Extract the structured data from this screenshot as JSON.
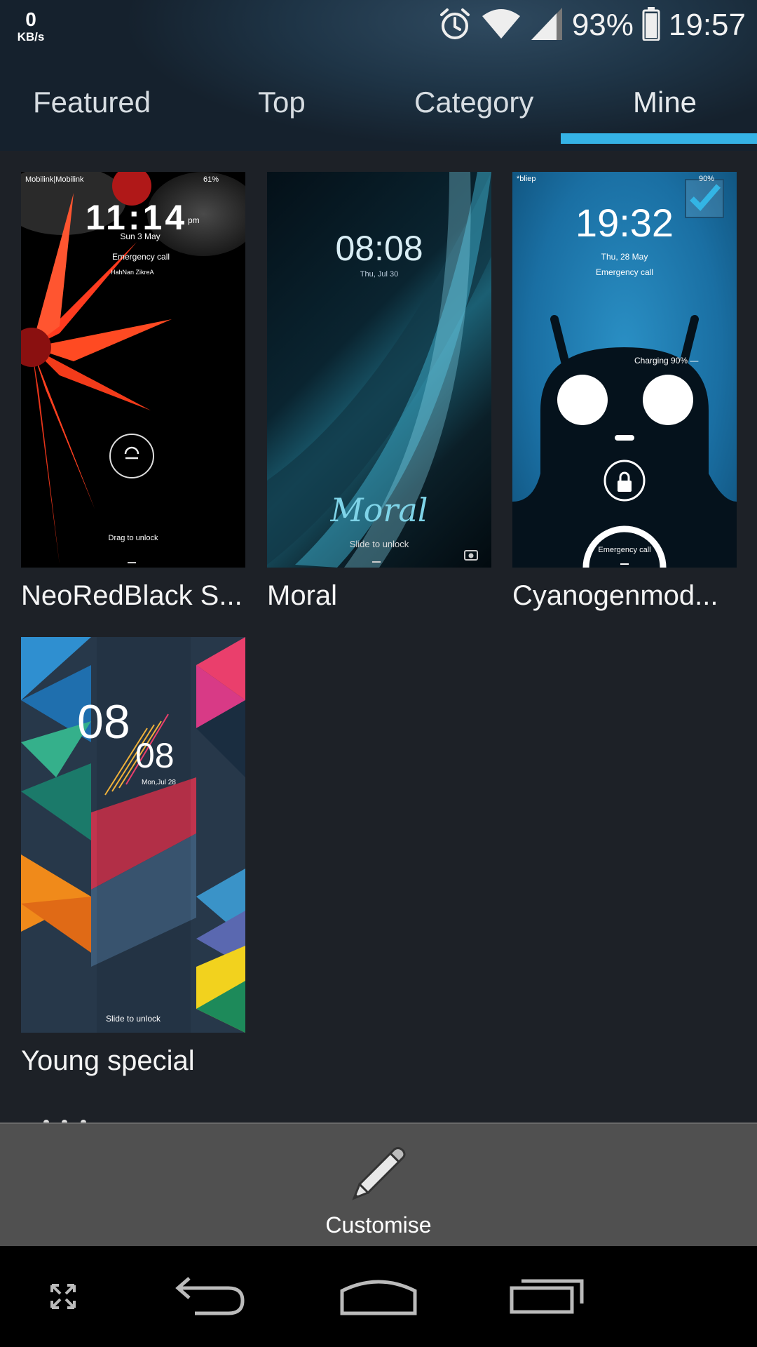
{
  "status_bar": {
    "net_speed_value": "0",
    "net_speed_unit": "KB/s",
    "battery": "93%",
    "time": "19:57",
    "icons": [
      "alarm-icon",
      "wifi-icon",
      "signal-icon",
      "battery-icon"
    ]
  },
  "tabs": [
    {
      "label": "Featured",
      "selected": false
    },
    {
      "label": "Top",
      "selected": false
    },
    {
      "label": "Category",
      "selected": false
    },
    {
      "label": "Mine",
      "selected": true
    }
  ],
  "colors": {
    "accent": "#35b3e6",
    "background": "#1d2127",
    "customise_bar": "#505050"
  },
  "themes": [
    {
      "name": "NeoRedBlack S...",
      "preview": {
        "carrier": "Mobilink|Mobilink",
        "battery": "61%",
        "time": "11:14",
        "ampm": "pm",
        "date": "Sun 3 May",
        "emergency": "Emergency call",
        "owner": "HahNan ZikreA",
        "unlock": "Drag to unlock"
      }
    },
    {
      "name": "Moral",
      "preview": {
        "time": "08:08",
        "date": "Thu, Jul 30",
        "script": "Moral",
        "unlock": "Slide to unlock"
      }
    },
    {
      "name": "Cyanogenmod...",
      "applied": true,
      "preview": {
        "carrier": "*bliep",
        "battery": "90%",
        "time": "19:32",
        "date": "Thu, 28 May",
        "emergency": "Emergency call",
        "charging": "Charging 90% —",
        "bottom": "Emergency call"
      }
    },
    {
      "name": "Young special",
      "preview": {
        "hour": "08",
        "minute": "08",
        "date": "Mon,Jul 28",
        "unlock": "Slide to unlock"
      }
    }
  ],
  "customise": {
    "label": "Customise",
    "icon": "pencil-icon"
  },
  "nav": [
    "expand-icon",
    "back-icon",
    "home-icon",
    "recents-icon"
  ]
}
